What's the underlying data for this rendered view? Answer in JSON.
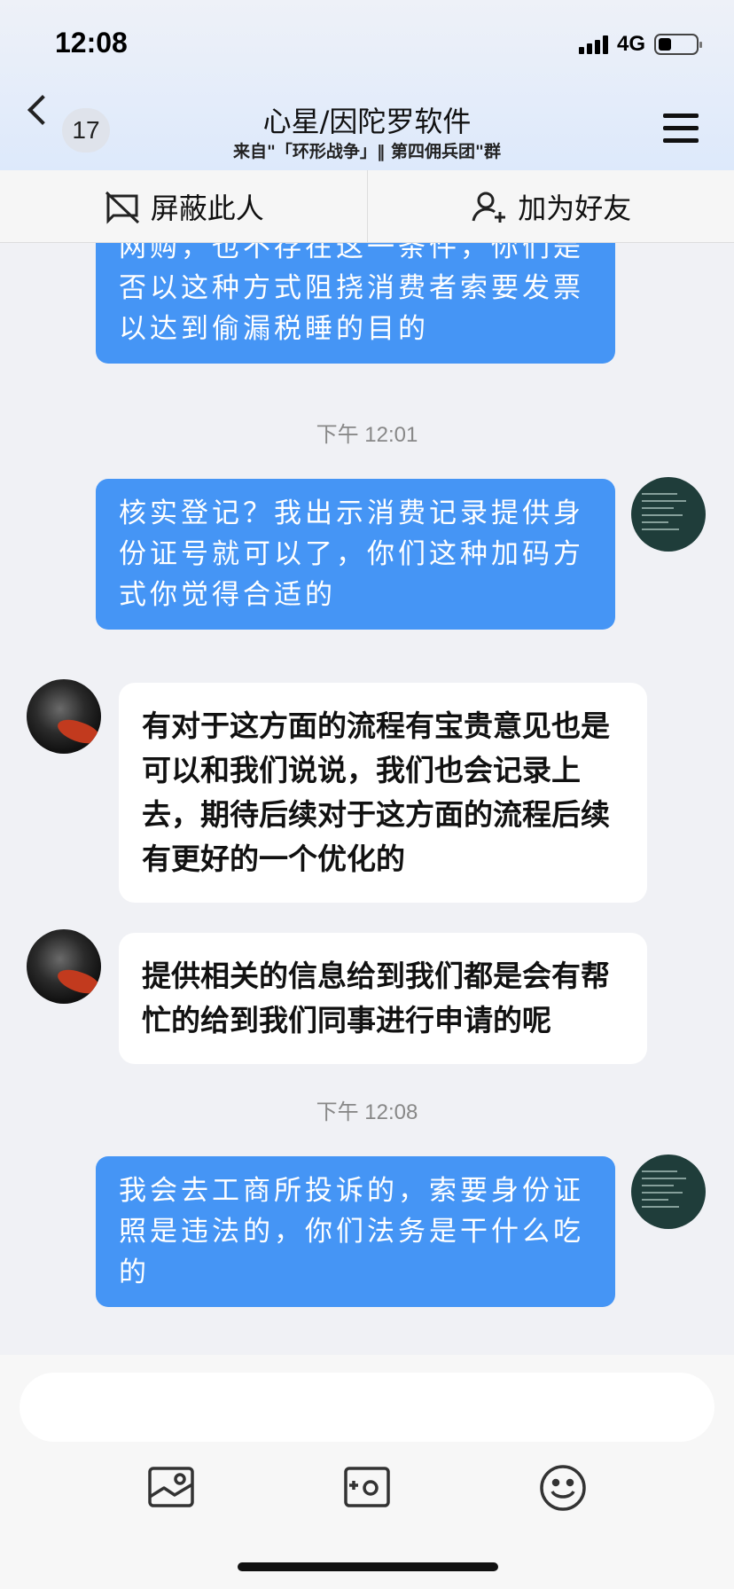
{
  "status": {
    "time": "12:08",
    "network": "4G"
  },
  "header": {
    "back_count": "17",
    "title": "心星/因陀罗软件",
    "subtitle": "来自\"「环形战争」‖ 第四佣兵团\"群"
  },
  "actions": {
    "block_label": "屏蔽此人",
    "add_friend_label": "加为好友"
  },
  "messages": [
    {
      "side": "out",
      "text": "网购，也不存在这一条件，你们是否以这种方式阻挠消费者索要发票以达到偷漏税睡的目的"
    },
    {
      "type": "time",
      "text": "下午 12:01"
    },
    {
      "side": "out",
      "text": "核实登记？我出示消费记录提供身份证号就可以了，你们这种加码方式你觉得合适的"
    },
    {
      "side": "in",
      "text": "有对于这方面的流程有宝贵意见也是可以和我们说说，我们也会记录上去，期待后续对于这方面的流程后续有更好的一个优化的"
    },
    {
      "side": "in",
      "text": "提供相关的信息给到我们都是会有帮忙的给到我们同事进行申请的呢"
    },
    {
      "type": "time",
      "text": "下午 12:08"
    },
    {
      "side": "out",
      "text": "我会去工商所投诉的，索要身份证照是违法的，你们法务是干什么吃的"
    }
  ],
  "input": {
    "placeholder": ""
  },
  "icons": {
    "block": "block-user-icon",
    "add_friend": "add-friend-icon",
    "image": "image-icon",
    "camera": "camera-icon",
    "emoji": "emoji-icon"
  },
  "colors": {
    "outgoing_bubble": "#4595f5",
    "incoming_bubble": "#ffffff",
    "chat_bg": "#f0f1f5"
  }
}
